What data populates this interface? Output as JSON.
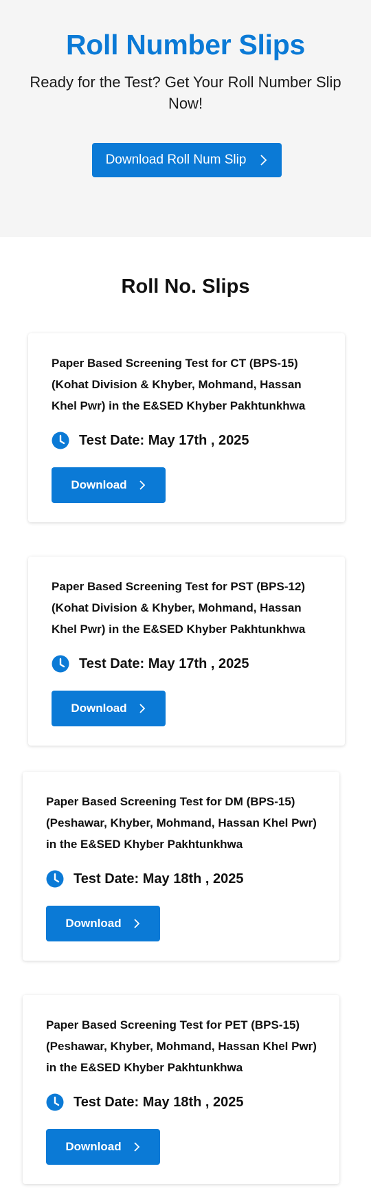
{
  "hero": {
    "title": "Roll Number Slips",
    "subtitle": "Ready for the Test? Get Your Roll Number Slip Now!",
    "button_label": "Download Roll Num Slip"
  },
  "section": {
    "title": "Roll No. Slips"
  },
  "cards": [
    {
      "title": "Paper Based Screening Test for CT (BPS-15) (Kohat Division & Khyber, Mohmand, Hassan Khel Pwr) in the E&SED Khyber Pakhtunkhwa",
      "date": "Test Date: May 17th , 2025",
      "button_label": "Download"
    },
    {
      "title": "Paper Based Screening Test for PST (BPS-12) (Kohat Division & Khyber, Mohmand, Hassan Khel Pwr) in the E&SED Khyber Pakhtunkhwa",
      "date": "Test Date: May 17th , 2025",
      "button_label": "Download"
    },
    {
      "title": "Paper Based Screening Test for DM (BPS-15) (Peshawar, Khyber, Mohmand, Hassan Khel Pwr) in the E&SED Khyber Pakhtunkhwa",
      "date": "Test Date: May 18th , 2025",
      "button_label": "Download"
    },
    {
      "title": "Paper Based Screening Test for PET (BPS-15) (Peshawar, Khyber, Mohmand, Hassan Khel Pwr) in the E&SED Khyber Pakhtunkhwa",
      "date": "Test Date: May 18th , 2025",
      "button_label": "Download"
    }
  ],
  "colors": {
    "accent": "#0b7ad6",
    "hero_background": "#f5f5f5"
  },
  "icons": {
    "button": "chevron-right-icon",
    "date": "clock-icon"
  }
}
